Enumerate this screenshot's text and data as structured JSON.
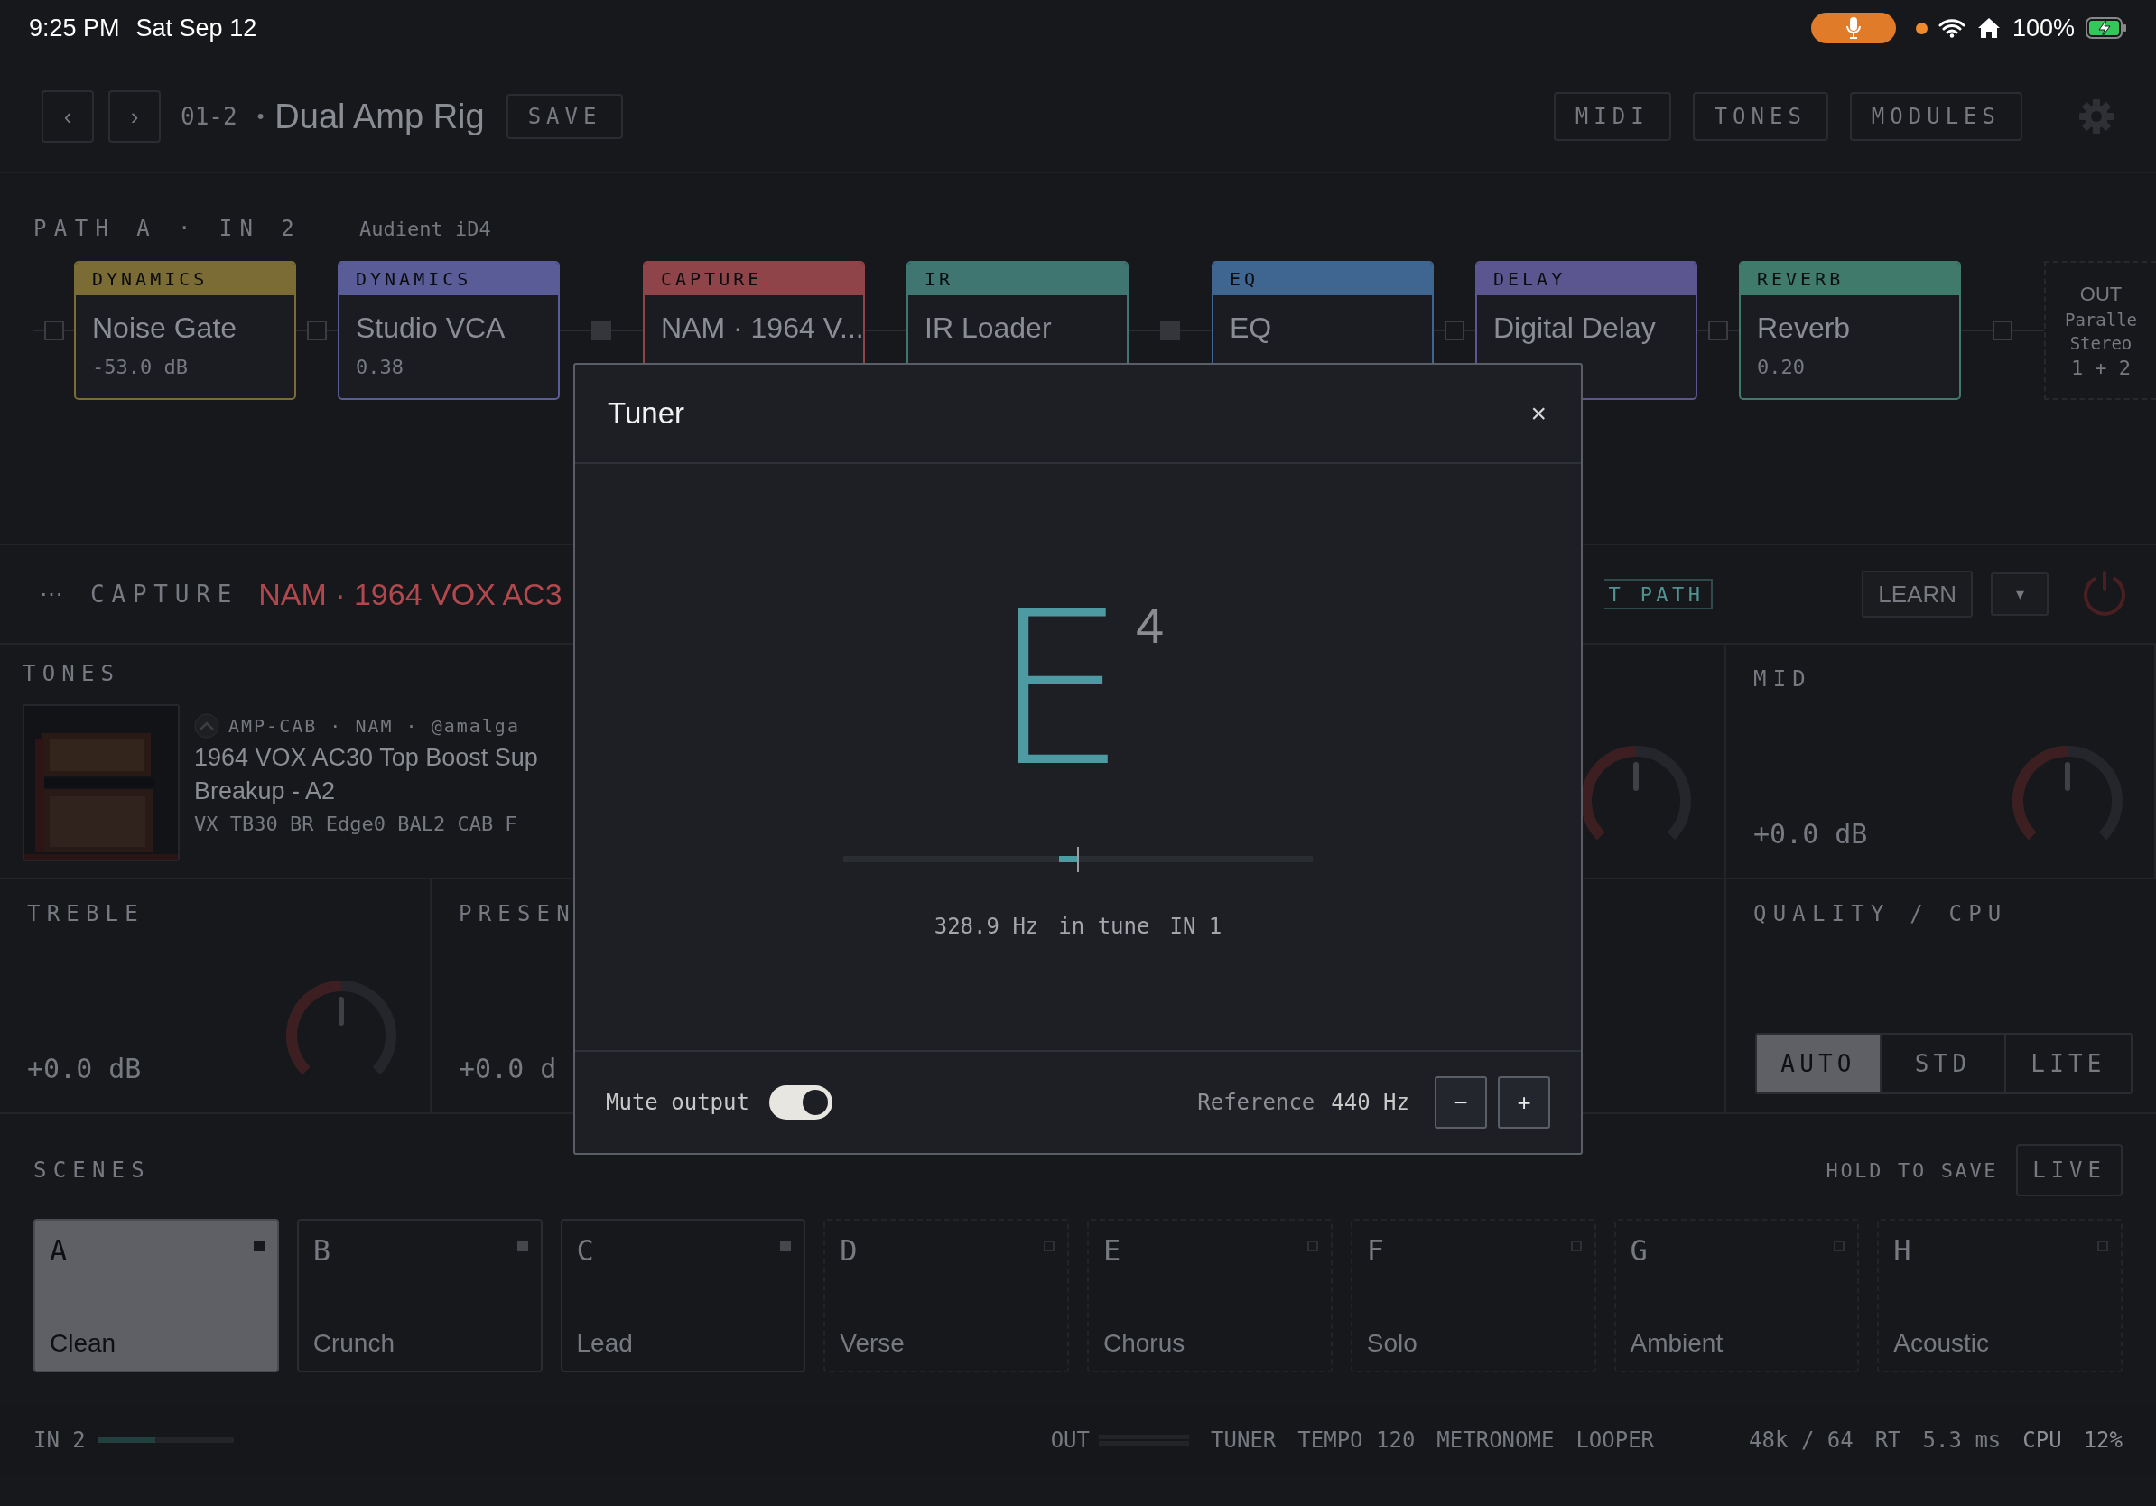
{
  "status_bar": {
    "time": "9:25 PM",
    "date": "Sat Sep 12",
    "battery": "100%"
  },
  "header": {
    "nav": [
      "‹",
      "›"
    ],
    "preset_number": "01-2",
    "bullet": "•",
    "preset_name": "Dual Amp Rig",
    "save": "SAVE",
    "buttons": [
      "MIDI",
      "TONES",
      "MODULES"
    ]
  },
  "path": {
    "label": "PATH A · IN 2",
    "device": "Audient iD4"
  },
  "chain": [
    {
      "category": "DYNAMICS",
      "name": "Noise Gate",
      "value": "-53.0 dB",
      "color": "#7a6c34"
    },
    {
      "category": "DYNAMICS",
      "name": "Studio VCA",
      "value": "0.38",
      "color": "#5a5c98"
    },
    {
      "category": "CAPTURE",
      "name": "NAM · 1964 V...",
      "color": "#8e4448"
    },
    {
      "category": "IR",
      "name": "IR Loader",
      "color": "#3f7672"
    },
    {
      "category": "EQ",
      "name": "EQ",
      "color": "#3f6690"
    },
    {
      "category": "DELAY",
      "name": "Digital Delay",
      "color": "#5c5690"
    },
    {
      "category": "REVERB",
      "name": "Reverb",
      "value": "0.20",
      "color": "#3f7a6a"
    }
  ],
  "connectors": [
    {
      "kind": "hollow"
    },
    {
      "kind": "hollow"
    },
    {
      "kind": "split"
    },
    {
      "kind": "line"
    },
    {
      "kind": "split"
    },
    {
      "kind": "hollow"
    },
    {
      "kind": "hollow"
    },
    {
      "kind": "hollow"
    }
  ],
  "output": {
    "label": "OUT",
    "lines": [
      "Paralle",
      "Stereo",
      "1 + 2"
    ]
  },
  "capture": {
    "menu": "⋯",
    "label": "CAPTURE",
    "title": "NAM · 1964 VOX AC3",
    "path_button": "T PATH",
    "learn": "LEARN",
    "dropdown": "▾"
  },
  "tones": {
    "label": "TONES",
    "tags": "AMP-CAB · NAM · @amalga",
    "title_lines": [
      "1964 VOX AC30 Top Boost Sup",
      "Breakup - A2"
    ],
    "settings": "VX TB30 BR Edge0 BAL2 CAB F"
  },
  "hidden_knob": {
    "level": 0.5
  },
  "mid": {
    "label": "MID",
    "value": "+0.0 dB",
    "level": 0.5
  },
  "treble": {
    "label": "TREBLE",
    "value": "+0.0 dB",
    "level": 0.5
  },
  "presence": {
    "label": "PRESEN",
    "value": "+0.0 d"
  },
  "quality": {
    "label": "QUALITY / CPU",
    "options": [
      {
        "label": "AUTO",
        "selected": true
      },
      {
        "label": "STD",
        "selected": false
      },
      {
        "label": "LITE",
        "selected": false
      }
    ]
  },
  "scenes": {
    "label": "SCENES",
    "hint": "HOLD TO SAVE",
    "live": "LIVE",
    "items": [
      {
        "letter": "A",
        "name": "Clean",
        "selected": true,
        "stored": true
      },
      {
        "letter": "B",
        "name": "Crunch",
        "selected": false,
        "stored": true
      },
      {
        "letter": "C",
        "name": "Lead",
        "selected": false,
        "stored": true
      },
      {
        "letter": "D",
        "name": "Verse",
        "selected": false,
        "stored": false
      },
      {
        "letter": "E",
        "name": "Chorus",
        "selected": false,
        "stored": false
      },
      {
        "letter": "F",
        "name": "Solo",
        "selected": false,
        "stored": false
      },
      {
        "letter": "G",
        "name": "Ambient",
        "selected": false,
        "stored": false
      },
      {
        "letter": "H",
        "name": "Acoustic",
        "selected": false,
        "stored": false
      }
    ]
  },
  "footer": {
    "input": {
      "label": "IN 2",
      "level": 0.42
    },
    "output_label": "OUT",
    "tools": [
      "TUNER",
      "TEMPO 120",
      "METRONOME",
      "LOOPER"
    ],
    "rate": "48k / 64",
    "rt_label": "RT",
    "rt_value": "5.3 ms",
    "cpu_label": "CPU",
    "cpu_value": "12%"
  },
  "tuner": {
    "title": "Tuner",
    "close": "×",
    "note": "E",
    "octave": "4",
    "level": 0.46,
    "frequency": "328.9 Hz",
    "status": "in tune",
    "input": "IN 1",
    "mute_label": "Mute output",
    "mute_on": true,
    "reference_label": "Reference",
    "reference_value": "440 Hz",
    "minus": "−",
    "plus": "+"
  }
}
